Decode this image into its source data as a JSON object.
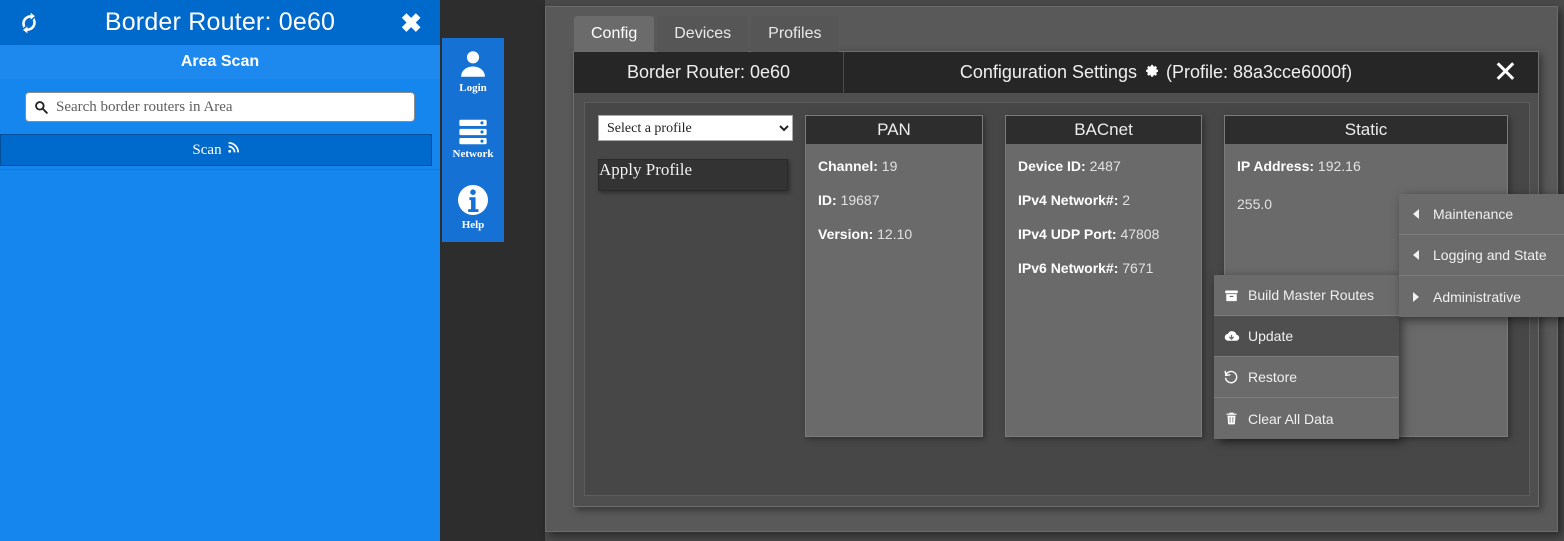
{
  "left_panel": {
    "refresh_icon": "refresh-icon",
    "title": "Border Router: 0e60",
    "close_icon": "close-icon",
    "subheader": "Area Scan",
    "search": {
      "icon": "search-icon",
      "value": "",
      "placeholder": "Search border routers in Area"
    },
    "scan_button": {
      "label": "Scan",
      "icon": "signal-icon"
    }
  },
  "nav_strip": {
    "items": [
      {
        "id": "login",
        "label": "Login",
        "icon": "user-icon"
      },
      {
        "id": "network",
        "label": "Network",
        "icon": "server-icon"
      },
      {
        "id": "help",
        "label": "Help",
        "icon": "info-icon"
      }
    ]
  },
  "main": {
    "tabs": [
      {
        "label": "Config",
        "active": true
      },
      {
        "label": "Devices",
        "active": false
      },
      {
        "label": "Profiles",
        "active": false
      }
    ],
    "panel_header": {
      "left_title": "Border Router: 0e60",
      "right_title": "Configuration Settings",
      "gear_icon": "gear-icon",
      "profile_suffix": "(Profile: 88a3cce6000f)",
      "close_icon": "close-icon"
    },
    "profile_column": {
      "select_value": "Select a profile",
      "select_options": [
        "Select a profile"
      ],
      "apply_label": "Apply Profile"
    },
    "cards": [
      {
        "title": "PAN",
        "rows": [
          {
            "key": "Channel:",
            "value": "19"
          },
          {
            "key": "ID:",
            "value": "19687"
          },
          {
            "key": "Version:",
            "value": "12.10"
          }
        ]
      },
      {
        "title": "BACnet",
        "rows": [
          {
            "key": "Device ID:",
            "value": "2487"
          },
          {
            "key": "IPv4 Network#:",
            "value": "2"
          },
          {
            "key": "IPv4 UDP Port:",
            "value": "47808"
          },
          {
            "key": "IPv6 Network#:",
            "value": "7671"
          }
        ]
      },
      {
        "title": "Static",
        "rows": [
          {
            "key": "IP Address:",
            "value": "192.16"
          },
          {
            "key": "",
            "value": "255.0"
          }
        ]
      }
    ]
  },
  "menus": {
    "maintenance": {
      "items": [
        {
          "label": "Maintenance",
          "arrow": "left",
          "hover": false
        },
        {
          "label": "Logging and State",
          "arrow": "left",
          "hover": false
        },
        {
          "label": "Administrative",
          "arrow": "right",
          "hover": false
        }
      ]
    },
    "administrative": {
      "items": [
        {
          "label": "Build Master Routes",
          "icon": "archive-icon",
          "hover": false
        },
        {
          "label": "Update",
          "icon": "cloud-download-icon",
          "hover": true
        },
        {
          "label": "Restore",
          "icon": "restore-icon",
          "hover": false
        },
        {
          "label": "Clear All Data",
          "icon": "trash-icon",
          "hover": false
        }
      ]
    }
  },
  "colors": {
    "brand_blue": "#1586ee",
    "title_blue": "#0069cc",
    "nav_blue": "#1572d4",
    "panel_dark": "#474747",
    "card_gray": "#6a6a6a",
    "card_header": "#2d2d2d"
  }
}
